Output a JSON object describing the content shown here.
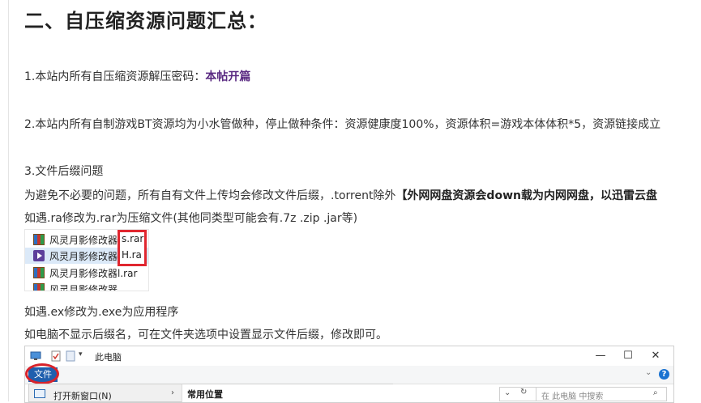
{
  "heading": "二、自压缩资源问题汇总：",
  "p1": {
    "text": "1.本站内所有自压缩资源解压密码：",
    "highlight": "本帖开篇"
  },
  "p2": "2.本站内所有自制游戏BT资源均为小水管做种，停止做种条件：资源健康度100%，资源体积=游戏本体体积*5，资源链接成立",
  "p3": "3.文件后缀问题",
  "p4": {
    "text": "为避免不必要的问题，所有自有文件上传均会修改文件后缀，.torrent除外",
    "strong": "【外网网盘资源会down载为内网网盘，以迅雷云盘"
  },
  "p5": "如遇.ra修改为.rar为压缩文件(其他同类型可能会有.7z .zip .jar等)",
  "file_list": {
    "rows": [
      {
        "name": "风灵月影修改器",
        "ext": "s.rar",
        "icon": "winrar-icon"
      },
      {
        "name": "风灵月影修改器",
        "ext": "H.ra",
        "icon": "media-player-icon"
      },
      {
        "name": "风灵月影修改器",
        "ext": "l.rar",
        "icon": "winrar-icon"
      },
      {
        "name": "风灵月影修改器",
        "ext": "",
        "icon": "winrar-icon"
      }
    ],
    "highlight_color": "#e0262f"
  },
  "p6": "如遇.ex修改为.exe为应用程序",
  "p7": "如电脑不显示后缀名，可在文件夹选项中设置显示文件后缀，修改即可。",
  "explorer": {
    "title": "此电脑",
    "minimize": "—",
    "maximize": "☐",
    "close": "✕",
    "file_tab": "文件",
    "help": "?",
    "menu_item": "打开新窗口(N)",
    "side_title": "常用位置",
    "search_placeholder": "在 此电脑 中搜索",
    "accent_color": "#1f5fae"
  }
}
